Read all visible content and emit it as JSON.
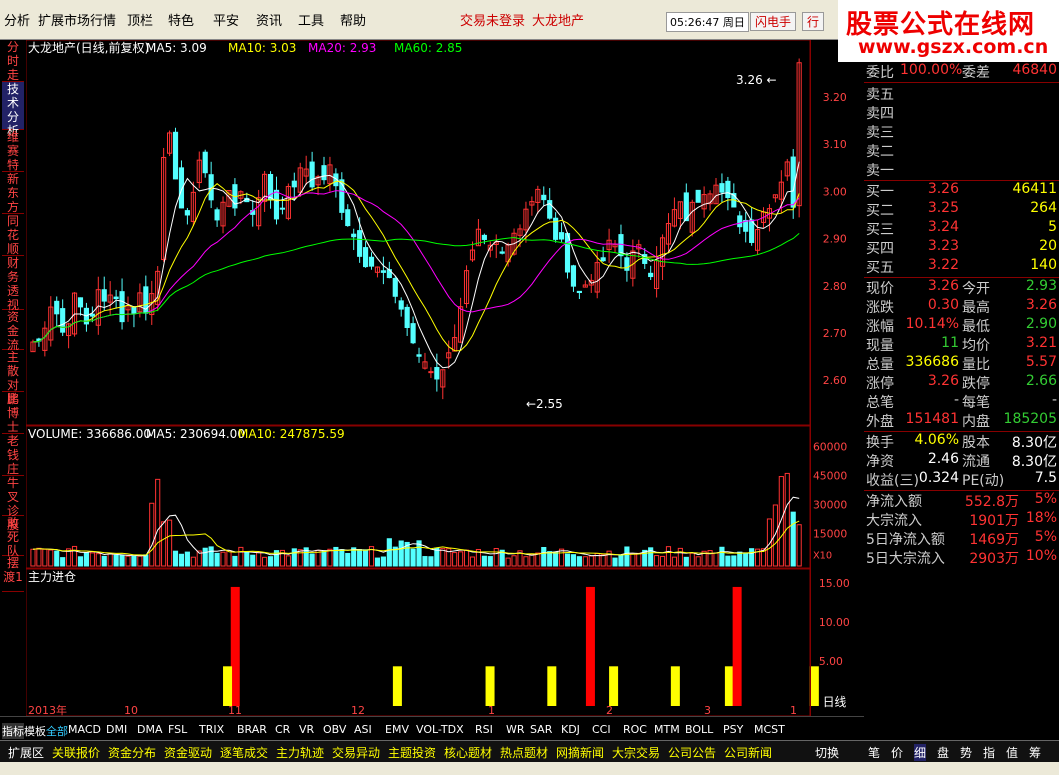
{
  "menu": {
    "items": [
      "分析",
      "扩展市场行情",
      "顶栏",
      "特色",
      "平安",
      "资讯",
      "工具",
      "帮助"
    ],
    "trade_status": "交易未登录",
    "stock": "大龙地产",
    "clock": "05:26:47 周日",
    "flash_btn": "闪电手",
    "trade_btn": "行"
  },
  "logo": {
    "line1": "股票公式在线网",
    "line2": "www.gszx.com.cn"
  },
  "left_tabs": [
    "分时走势",
    "技术分析",
    "维赛特",
    "新东方",
    "同花顺",
    "财务透视",
    "资金流",
    "主散对比",
    "鹏博士",
    "老钱庄",
    "牛叉诊股",
    "敢死队",
    "摆渡1"
  ],
  "main_chart": {
    "title": "大龙地产(日线,前复权)",
    "ma5": "MA5: 3.09",
    "ma10": "MA10: 3.03",
    "ma20": "MA20: 2.93",
    "ma60": "MA60: 2.85",
    "y_ticks": [
      "3.20",
      "3.10",
      "3.00",
      "2.90",
      "2.80",
      "2.70",
      "2.60"
    ],
    "high_label": "3.26",
    "low_label": "2.55"
  },
  "volume_chart": {
    "title": "VOLUME: 336686.00",
    "ma5": "MA5: 230694.00",
    "ma10": "MA10: 247875.59",
    "y_ticks": [
      "60000",
      "45000",
      "30000",
      "15000"
    ],
    "unit": "X10"
  },
  "signal_chart": {
    "title": "主力进仓",
    "y_ticks": [
      "15.00",
      "10.00",
      "5.00"
    ]
  },
  "x_axis": {
    "labels": [
      "2013年",
      "10",
      "11",
      "12",
      "1",
      "2",
      "3",
      "1"
    ],
    "period": "日线"
  },
  "indicator_tabs": [
    "指标",
    "模板",
    "全部",
    "MACD",
    "DMI",
    "DMA",
    "FSL",
    "TRIX",
    "BRAR",
    "CR",
    "VR",
    "OBV",
    "ASI",
    "EMV",
    "VOL-TDX",
    "RSI",
    "WR",
    "SAR",
    "KDJ",
    "CCI",
    "ROC",
    "MTM",
    "BOLL",
    "PSY",
    "MCST"
  ],
  "bottom_tabs": [
    "扩展区",
    "关联报价",
    "资金分布",
    "资金驱动",
    "逐笔成交",
    "主力轨迹",
    "交易异动",
    "主题投资",
    "核心题材",
    "热点题材",
    "网摘新闻",
    "大宗交易",
    "公司公告",
    "公司新闻"
  ],
  "bottom_switch": "切换",
  "right_tabs": [
    "笔",
    "价",
    "细",
    "盘",
    "势",
    "指",
    "值",
    "筹"
  ],
  "quote": {
    "weibi": {
      "label": "委比",
      "value": "100.00%",
      "label2": "委差",
      "value2": "46840"
    },
    "sell": [
      {
        "label": "卖五",
        "price": "",
        "vol": ""
      },
      {
        "label": "卖四",
        "price": "",
        "vol": ""
      },
      {
        "label": "卖三",
        "price": "",
        "vol": ""
      },
      {
        "label": "卖二",
        "price": "",
        "vol": ""
      },
      {
        "label": "卖一",
        "price": "",
        "vol": ""
      }
    ],
    "buy": [
      {
        "label": "买一",
        "price": "3.26",
        "vol": "46411"
      },
      {
        "label": "买二",
        "price": "3.25",
        "vol": "264"
      },
      {
        "label": "买三",
        "price": "3.24",
        "vol": "5"
      },
      {
        "label": "买四",
        "price": "3.23",
        "vol": "20"
      },
      {
        "label": "买五",
        "price": "3.22",
        "vol": "140"
      }
    ],
    "stats": [
      {
        "l1": "现价",
        "v1": "3.26",
        "c1": "#f33",
        "l2": "今开",
        "v2": "2.93",
        "c2": "#3c3"
      },
      {
        "l1": "涨跌",
        "v1": "0.30",
        "c1": "#f33",
        "l2": "最高",
        "v2": "3.26",
        "c2": "#f33"
      },
      {
        "l1": "涨幅",
        "v1": "10.14%",
        "c1": "#f33",
        "l2": "最低",
        "v2": "2.90",
        "c2": "#3c3"
      },
      {
        "l1": "现量",
        "v1": "11",
        "c1": "#3c3",
        "l2": "均价",
        "v2": "3.21",
        "c2": "#f33"
      },
      {
        "l1": "总量",
        "v1": "336686",
        "c1": "#ff0",
        "l2": "量比",
        "v2": "5.57",
        "c2": "#f33"
      },
      {
        "l1": "涨停",
        "v1": "3.26",
        "c1": "#f33",
        "l2": "跌停",
        "v2": "2.66",
        "c2": "#3c3"
      },
      {
        "l1": "总笔",
        "v1": "-",
        "c1": "#ccc",
        "l2": "每笔",
        "v2": "-",
        "c2": "#ccc"
      },
      {
        "l1": "外盘",
        "v1": "151481",
        "c1": "#f33",
        "l2": "内盘",
        "v2": "185205",
        "c2": "#3c3"
      }
    ],
    "fund": [
      {
        "l1": "换手",
        "v1": "4.06%",
        "c1": "#ff0",
        "l2": "股本",
        "v2": "8.30亿",
        "c2": "#fff"
      },
      {
        "l1": "净资",
        "v1": "2.46",
        "c1": "#fff",
        "l2": "流通",
        "v2": "8.30亿",
        "c2": "#fff"
      },
      {
        "l1": "收益(三)",
        "v1": "0.324",
        "c1": "#fff",
        "l2": "PE(动)",
        "v2": "7.5",
        "c2": "#fff"
      }
    ],
    "flow": [
      {
        "label": "净流入额",
        "value": "552.8万",
        "pct": "5%"
      },
      {
        "label": "大宗流入",
        "value": "1901万",
        "pct": "18%"
      },
      {
        "label": "5日净流入额",
        "value": "1469万",
        "pct": "5%"
      },
      {
        "label": "5日大宗流入",
        "value": "2903万",
        "pct": "10%"
      }
    ]
  },
  "status_text": "",
  "colors": {
    "up": "#ff3232",
    "down": "#54ffff",
    "ma5": "#ffffff",
    "ma10": "#ffff00",
    "ma20": "#ff00ff",
    "ma60": "#00ff00",
    "signal_red": "#ff0000",
    "signal_yellow": "#ffff00"
  }
}
